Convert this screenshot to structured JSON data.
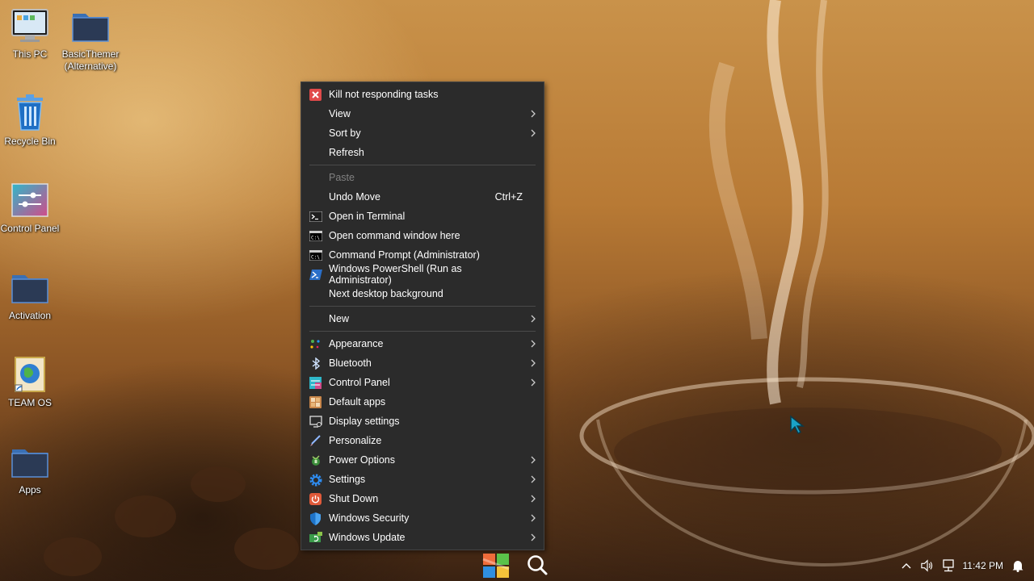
{
  "desktop": {
    "icons": [
      {
        "label": "This PC"
      },
      {
        "label": "BasicThemer (Alternative)"
      },
      {
        "label": "Recycle Bin"
      },
      {
        "label": "Control Panel"
      },
      {
        "label": "Activation"
      },
      {
        "label": "TEAM OS"
      },
      {
        "label": "Apps"
      }
    ]
  },
  "context_menu": {
    "items": [
      {
        "label": "Kill not responding tasks",
        "icon": "kill-tasks-icon"
      },
      {
        "label": "View",
        "submenu": true
      },
      {
        "label": "Sort by",
        "submenu": true
      },
      {
        "label": "Refresh"
      },
      {
        "label": "Paste",
        "disabled": true
      },
      {
        "label": "Undo Move",
        "shortcut": "Ctrl+Z"
      },
      {
        "label": "Open in Terminal",
        "icon": "terminal-icon"
      },
      {
        "label": "Open command window here",
        "icon": "cmd-icon"
      },
      {
        "label": "Command Prompt (Administrator)",
        "icon": "cmd-icon"
      },
      {
        "label": "Windows PowerShell (Run as Administrator)",
        "icon": "powershell-icon"
      },
      {
        "label": "Next desktop background"
      },
      {
        "label": "New",
        "submenu": true
      },
      {
        "label": "Appearance",
        "icon": "appearance-icon",
        "submenu": true
      },
      {
        "label": "Bluetooth",
        "icon": "bluetooth-icon",
        "submenu": true
      },
      {
        "label": "Control Panel",
        "icon": "control-panel-icon",
        "submenu": true
      },
      {
        "label": "Default apps",
        "icon": "default-apps-icon"
      },
      {
        "label": "Display settings",
        "icon": "display-icon"
      },
      {
        "label": "Personalize",
        "icon": "personalize-icon"
      },
      {
        "label": "Power Options",
        "icon": "power-options-icon",
        "submenu": true
      },
      {
        "label": "Settings",
        "icon": "settings-gear-icon",
        "submenu": true
      },
      {
        "label": "Shut Down",
        "icon": "shutdown-icon",
        "submenu": true
      },
      {
        "label": "Windows Security",
        "icon": "shield-icon",
        "submenu": true
      },
      {
        "label": "Windows Update",
        "icon": "windows-update-icon",
        "submenu": true
      }
    ]
  },
  "taskbar": {
    "clock": "11:42 PM"
  },
  "colors": {
    "menu_bg": "#2b2b2b",
    "menu_text": "#ffffff",
    "menu_disabled": "#808080",
    "accent": "#0078d7"
  }
}
